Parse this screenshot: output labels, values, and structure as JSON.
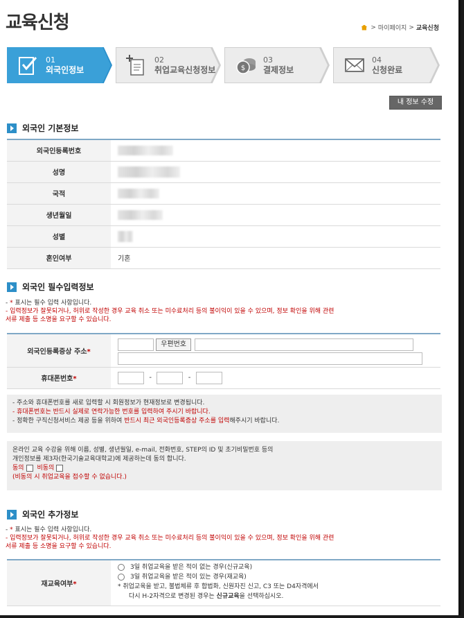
{
  "page_title": "교육신청",
  "breadcrumb": {
    "items": [
      "마이페이지",
      "교육신청"
    ],
    "separator": ">"
  },
  "steps": [
    {
      "num": "01",
      "label": "외국인정보",
      "active": true,
      "icon": "checklist-icon"
    },
    {
      "num": "02",
      "label": "취업교육신청정보",
      "active": false,
      "icon": "add-document-icon"
    },
    {
      "num": "03",
      "label": "결제정보",
      "active": false,
      "icon": "coins-icon"
    },
    {
      "num": "04",
      "label": "신청완료",
      "active": false,
      "icon": "envelope-icon"
    }
  ],
  "edit_button": "내 정보 수정",
  "basic": {
    "title": "외국인 기본정보",
    "rows": [
      {
        "label": "외국인등록번호",
        "value": ""
      },
      {
        "label": "성명",
        "value": ""
      },
      {
        "label": "국적",
        "value": ""
      },
      {
        "label": "생년월일",
        "value": ""
      },
      {
        "label": "성별",
        "value": ""
      },
      {
        "label": "혼인여부",
        "value": "기혼"
      }
    ]
  },
  "required": {
    "title": "외국인 필수입력정보",
    "note1_prefix": "- ",
    "note1_star": "*",
    "note1_text": " 표시는 필수 입력 사항입니다.",
    "note2": "- 입력정보가 잘못되거나, 허위로 작성한 경우 교육 취소 또는 미수료처리 등의 불이익이 있을 수 있으며, 정보 확인을 위해 관련",
    "note2b": "서류 제출 등 소명을 요구할 수 있습니다.",
    "address_label": "외국인등록증상 주소",
    "zip_button": "우편번호",
    "phone_label": "휴대폰번호",
    "phone_sep": "-",
    "star": "*"
  },
  "notice": {
    "line1": "- 주소와 휴대폰번호를 새로 입력할 시 회원정보가 현재정보로 변경됩니다.",
    "line2": "- 휴대폰번호는 반드시 실제로 연락가능한 번호를 입력하여 주시기 바랍니다.",
    "line3_a": "- 정확한 구직신청서비스 제공 등을 위하여 ",
    "line3_b": "반드시 최근 외국인등록증상 주소를 입력",
    "line3_c": "해주시기 바랍니다."
  },
  "consent": {
    "line1": "온라인 교육 수강을 위해 이름, 성별, 생년월일, e-mail, 전화번호, STEP의 ID 및 초기비밀번호 등의",
    "line2": "개인정보를 제3자(한국기술교육대학교)에 제공하는데 동의 합니다.",
    "agree": "동의",
    "disagree": "비동의",
    "warning": "(비동의 시 취업교육을 접수할 수 없습니다.)"
  },
  "additional": {
    "title": "외국인 추가정보",
    "note1_prefix": "- ",
    "note1_star": "*",
    "note1_text": " 표시는 필수 입력 사항입니다.",
    "note2": "- 입력정보가 잘못되거나, 허위로 작성한 경우 교육 취소 또는 미수료처리 등의 불이익이 있을 수 있으며, 정보 확인을 위해 관련",
    "note2b": "서류 제출 등 소명을 요구할 수 있습니다.",
    "reedu_label": "재교육여부",
    "opt1": "3일 취업교육을 받은 적이 없는 경우(신규교육)",
    "opt2": "3일 취업교육을 받은 적이 있는 경우(재교육)",
    "hint1": "* 취업교육을 받고, 불법체류 후 합법화, 신원자진 신고, C3 또는 D4자격에서",
    "hint2_a": "다시 H-2자격으로 변경된 경우는 ",
    "hint2_b": "신규교육",
    "hint2_c": "을 선택하십시오.",
    "star": "*"
  },
  "colors": {
    "step_active": "#3aa0d8",
    "section_marker": "#2d8fc8",
    "required_red": "#c00000"
  }
}
